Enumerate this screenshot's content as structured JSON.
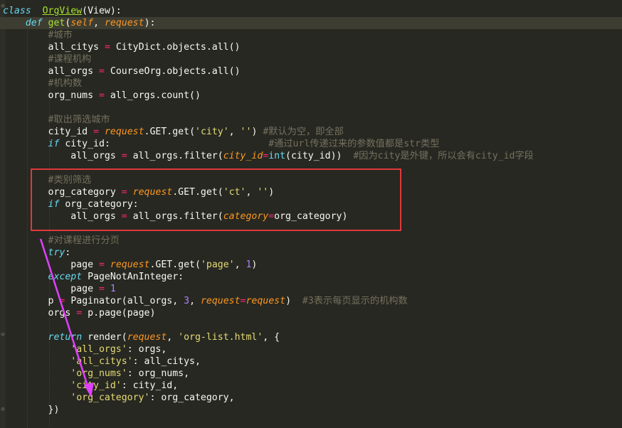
{
  "lines": [
    {
      "indent": "",
      "tokens": [
        [
          "kw",
          "class"
        ],
        [
          "",
          "  "
        ],
        [
          "cls",
          "OrgView"
        ],
        [
          "",
          "(View):"
        ]
      ]
    },
    {
      "indent": "    ",
      "tokens": [
        [
          "kw",
          "def"
        ],
        [
          "",
          " "
        ],
        [
          "fn",
          "get"
        ],
        [
          "",
          "("
        ],
        [
          "par",
          "self"
        ],
        [
          "",
          ", "
        ],
        [
          "par",
          "request"
        ],
        [
          "",
          "):"
        ]
      ]
    },
    {
      "indent": "        ",
      "tokens": [
        [
          "cmt",
          "#城市"
        ]
      ]
    },
    {
      "indent": "        ",
      "tokens": [
        [
          "",
          "all_citys "
        ],
        [
          "op",
          "="
        ],
        [
          "",
          " CityDict.objects.all()"
        ]
      ]
    },
    {
      "indent": "        ",
      "tokens": [
        [
          "cmt",
          "#课程机构"
        ]
      ]
    },
    {
      "indent": "        ",
      "tokens": [
        [
          "",
          "all_orgs "
        ],
        [
          "op",
          "="
        ],
        [
          "",
          " CourseOrg.objects.all()"
        ]
      ]
    },
    {
      "indent": "        ",
      "tokens": [
        [
          "cmt",
          "#机构数"
        ]
      ]
    },
    {
      "indent": "        ",
      "tokens": [
        [
          "",
          "org_nums "
        ],
        [
          "op",
          "="
        ],
        [
          "",
          " all_orgs.count()"
        ]
      ]
    },
    {
      "indent": "",
      "tokens": [
        [
          "",
          ""
        ]
      ]
    },
    {
      "indent": "        ",
      "tokens": [
        [
          "cmt",
          "#取出筛选城市"
        ]
      ]
    },
    {
      "indent": "        ",
      "tokens": [
        [
          "",
          "city_id "
        ],
        [
          "op",
          "="
        ],
        [
          "",
          " "
        ],
        [
          "par",
          "request"
        ],
        [
          "",
          ".GET.get("
        ],
        [
          "str",
          "'city'"
        ],
        [
          "",
          ", "
        ],
        [
          "str",
          "''"
        ],
        [
          "",
          ") "
        ],
        [
          "cmt",
          "#默认为空，即全部"
        ]
      ]
    },
    {
      "indent": "        ",
      "tokens": [
        [
          "kw",
          "if"
        ],
        [
          "",
          " city_id:                            "
        ],
        [
          "cmt",
          "#通过url传递过来的参数值都是str类型"
        ]
      ]
    },
    {
      "indent": "            ",
      "tokens": [
        [
          "",
          "all_orgs "
        ],
        [
          "op",
          "="
        ],
        [
          "",
          " all_orgs.filter("
        ],
        [
          "kwarg",
          "city_id"
        ],
        [
          "op",
          "="
        ],
        [
          "bi",
          "int"
        ],
        [
          "",
          "(city_id))  "
        ],
        [
          "cmt",
          "#因为city是外键，所以会有city_id字段"
        ]
      ]
    },
    {
      "indent": "",
      "tokens": [
        [
          "",
          ""
        ]
      ]
    },
    {
      "indent": "        ",
      "tokens": [
        [
          "cmt",
          "#类别筛选"
        ]
      ]
    },
    {
      "indent": "        ",
      "tokens": [
        [
          "",
          "org_category "
        ],
        [
          "op",
          "="
        ],
        [
          "",
          " "
        ],
        [
          "par",
          "request"
        ],
        [
          "",
          ".GET.get("
        ],
        [
          "str",
          "'ct'"
        ],
        [
          "",
          ", "
        ],
        [
          "str",
          "''"
        ],
        [
          "",
          ")"
        ]
      ]
    },
    {
      "indent": "        ",
      "tokens": [
        [
          "kw",
          "if"
        ],
        [
          "",
          " org_category:"
        ]
      ]
    },
    {
      "indent": "            ",
      "tokens": [
        [
          "",
          "all_orgs "
        ],
        [
          "op",
          "="
        ],
        [
          "",
          " all_orgs.filter("
        ],
        [
          "kwarg",
          "category"
        ],
        [
          "op",
          "="
        ],
        [
          "",
          "org_category)"
        ]
      ]
    },
    {
      "indent": "",
      "tokens": [
        [
          "",
          ""
        ]
      ]
    },
    {
      "indent": "        ",
      "tokens": [
        [
          "cmt",
          "#对课程进行分页"
        ]
      ]
    },
    {
      "indent": "        ",
      "tokens": [
        [
          "kw",
          "try"
        ],
        [
          "",
          ":"
        ]
      ]
    },
    {
      "indent": "            ",
      "tokens": [
        [
          "",
          "page "
        ],
        [
          "op",
          "="
        ],
        [
          "",
          " "
        ],
        [
          "par",
          "request"
        ],
        [
          "",
          ".GET.get("
        ],
        [
          "str",
          "'page'"
        ],
        [
          "",
          ", "
        ],
        [
          "num",
          "1"
        ],
        [
          "",
          ")"
        ]
      ]
    },
    {
      "indent": "        ",
      "tokens": [
        [
          "kw",
          "except"
        ],
        [
          "",
          " PageNotAnInteger:"
        ]
      ]
    },
    {
      "indent": "            ",
      "tokens": [
        [
          "",
          "page "
        ],
        [
          "op",
          "="
        ],
        [
          "",
          " "
        ],
        [
          "num",
          "1"
        ]
      ]
    },
    {
      "indent": "        ",
      "tokens": [
        [
          "",
          "p "
        ],
        [
          "op",
          "="
        ],
        [
          "",
          " Paginator(all_orgs, "
        ],
        [
          "num",
          "3"
        ],
        [
          "",
          ", "
        ],
        [
          "kwarg",
          "request"
        ],
        [
          "op",
          "="
        ],
        [
          "par",
          "request"
        ],
        [
          "",
          ")  "
        ],
        [
          "cmt",
          "#3表示每页显示的机构数"
        ]
      ]
    },
    {
      "indent": "        ",
      "tokens": [
        [
          "",
          "orgs "
        ],
        [
          "op",
          "="
        ],
        [
          "",
          " p.page(page)"
        ]
      ]
    },
    {
      "indent": "",
      "tokens": [
        [
          "",
          ""
        ]
      ]
    },
    {
      "indent": "        ",
      "tokens": [
        [
          "kw",
          "return"
        ],
        [
          "",
          " render("
        ],
        [
          "par",
          "request"
        ],
        [
          "",
          ", "
        ],
        [
          "str",
          "'org-list.html'"
        ],
        [
          "",
          ", {"
        ]
      ]
    },
    {
      "indent": "            ",
      "tokens": [
        [
          "str",
          "'all_orgs'"
        ],
        [
          "",
          ": orgs,"
        ]
      ]
    },
    {
      "indent": "            ",
      "tokens": [
        [
          "str",
          "'all_citys'"
        ],
        [
          "",
          ": all_citys,"
        ]
      ]
    },
    {
      "indent": "            ",
      "tokens": [
        [
          "str",
          "'org_nums'"
        ],
        [
          "",
          ": org_nums,"
        ]
      ]
    },
    {
      "indent": "            ",
      "tokens": [
        [
          "str",
          "'city_id'"
        ],
        [
          "",
          ": city_id,"
        ]
      ]
    },
    {
      "indent": "            ",
      "tokens": [
        [
          "str",
          "'org_category'"
        ],
        [
          "",
          ": org_category,"
        ]
      ]
    },
    {
      "indent": "        ",
      "tokens": [
        [
          "",
          "})"
        ]
      ]
    }
  ],
  "highlight_color": "#e0383b",
  "arrow_color": "#e040fb"
}
